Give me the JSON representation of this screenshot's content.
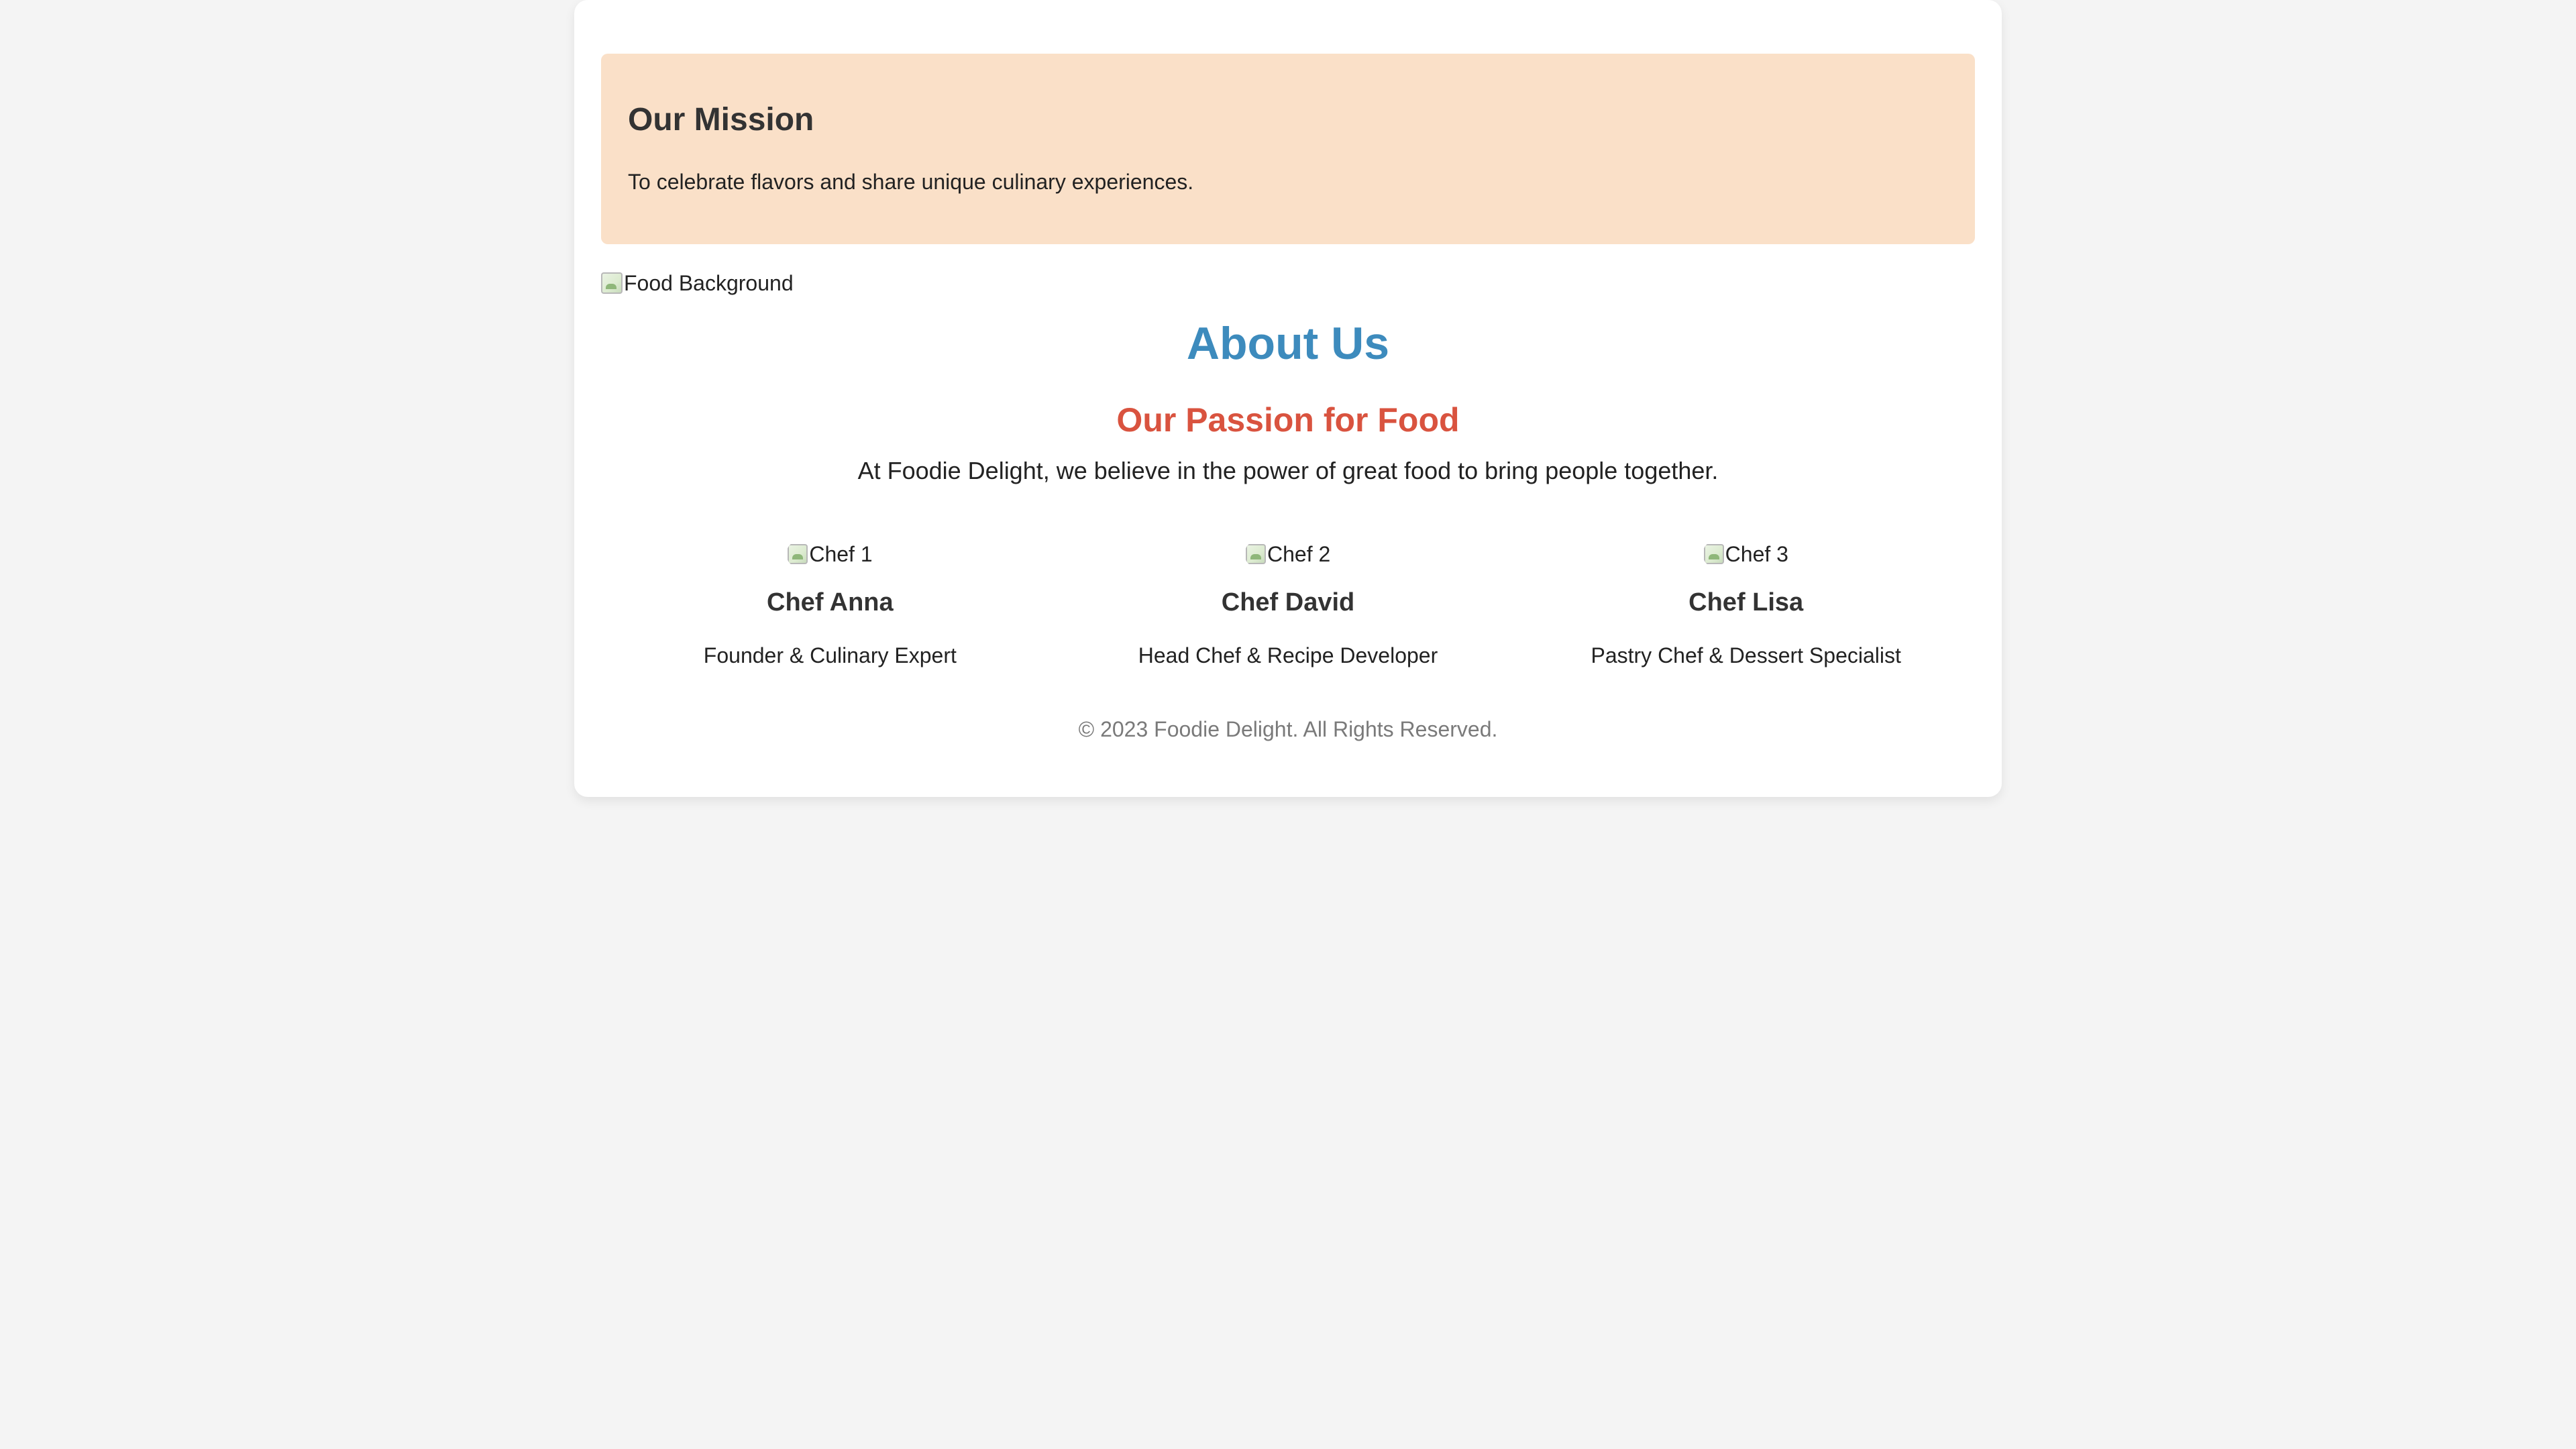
{
  "mission": {
    "title": "Our Mission",
    "text": "To celebrate flavors and share unique culinary experiences."
  },
  "hero_image": {
    "alt": "Food Background",
    "icon": "broken-image-icon"
  },
  "about": {
    "title": "About Us",
    "subtitle": "Our Passion for Food",
    "intro": "At Foodie Delight, we believe in the power of great food to bring people together."
  },
  "team": [
    {
      "image_alt": "Chef 1",
      "name": "Chef Anna",
      "role": "Founder & Culinary Expert"
    },
    {
      "image_alt": "Chef 2",
      "name": "Chef David",
      "role": "Head Chef & Recipe Developer"
    },
    {
      "image_alt": "Chef 3",
      "name": "Chef Lisa",
      "role": "Pastry Chef & Dessert Specialist"
    }
  ],
  "footer": {
    "copyright": "© 2023 Foodie Delight. All Rights Reserved."
  },
  "colors": {
    "page_background": "#f4f4f4",
    "card_background": "#ffffff",
    "mission_background": "#fae0c8",
    "about_title": "#3d8bbd",
    "passion_title": "#d9533f",
    "footer_text": "#7a7a7a"
  }
}
